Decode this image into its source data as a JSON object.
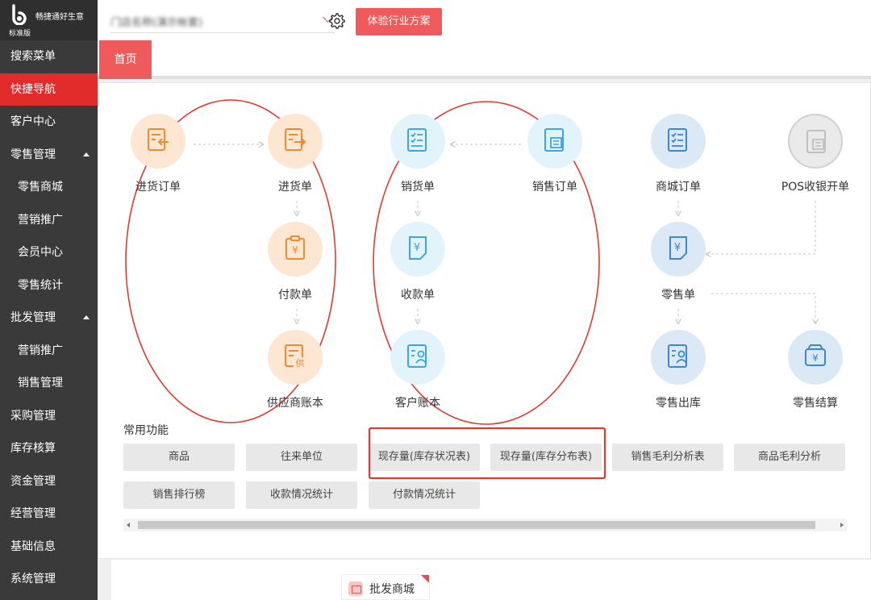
{
  "brand": {
    "name": "畅捷通好生意",
    "edition": "标准版"
  },
  "sidebar": {
    "items": [
      {
        "label": "搜索菜单"
      },
      {
        "label": "快捷导航"
      },
      {
        "label": "客户中心"
      },
      {
        "label": "零售管理"
      },
      {
        "label": "零售商城"
      },
      {
        "label": "营销推广"
      },
      {
        "label": "会员中心"
      },
      {
        "label": "零售统计"
      },
      {
        "label": "批发管理"
      },
      {
        "label": "营销推广"
      },
      {
        "label": "销售管理"
      },
      {
        "label": "采购管理"
      },
      {
        "label": "库存核算"
      },
      {
        "label": "资金管理"
      },
      {
        "label": "经营管理"
      },
      {
        "label": "基础信息"
      },
      {
        "label": "系统管理"
      }
    ]
  },
  "header": {
    "store_value": "门店名称(演示帐套)",
    "trial_button": "体验行业方案"
  },
  "tabs": [
    {
      "label": "首页"
    }
  ],
  "flow": {
    "purchase_order": "进货订单",
    "purchase": "进货单",
    "payment": "付款单",
    "supplier_ledger": "供应商账本",
    "sales": "销货单",
    "sales_order": "销售订单",
    "receipt": "收款单",
    "customer_ledger": "客户账本",
    "mall_order": "商城订单",
    "pos": "POS收银开单",
    "retail": "零售单",
    "retail_outbound": "零售出库",
    "retail_settle": "零售结算"
  },
  "common": {
    "title": "常用功能",
    "buttons": [
      "商品",
      "往来单位",
      "现存量(库存状况表)",
      "现存量(库存分布表)",
      "销售毛利分析表",
      "商品毛利分析",
      "销售排行榜",
      "收款情况统计",
      "付款情况统计"
    ]
  },
  "bottom": {
    "wholesale_mall": "批发商城"
  },
  "colors": {
    "accent": "#e22b2b",
    "button": "#f05a5a",
    "annotation": "#e03a2f",
    "sidebar": "#3a3a3a"
  }
}
